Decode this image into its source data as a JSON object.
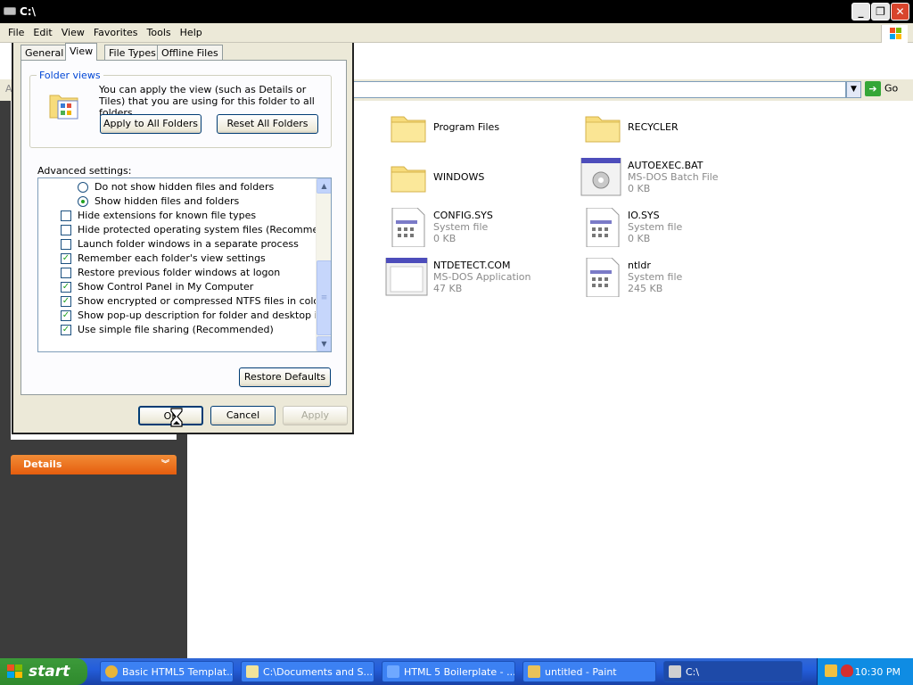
{
  "window": {
    "title": "C:\\"
  },
  "menu": [
    "File",
    "Edit",
    "View",
    "Favorites",
    "Tools",
    "Help"
  ],
  "address": {
    "go_label": "Go",
    "stub": "A"
  },
  "sidebar": {
    "details_label": "Details"
  },
  "files": [
    {
      "name": "Program Files",
      "type": "",
      "size": "",
      "icon": "folder-icon"
    },
    {
      "name": "RECYCLER",
      "type": "",
      "size": "",
      "icon": "folder-icon"
    },
    {
      "name": "WINDOWS",
      "type": "",
      "size": "",
      "icon": "folder-icon"
    },
    {
      "name": "AUTOEXEC.BAT",
      "type": "MS-DOS Batch File",
      "size": "0 KB",
      "icon": "batch-file-icon"
    },
    {
      "name": "CONFIG.SYS",
      "type": "System file",
      "size": "0 KB",
      "icon": "system-file-icon"
    },
    {
      "name": "IO.SYS",
      "type": "System file",
      "size": "0 KB",
      "icon": "system-file-icon"
    },
    {
      "name": "NTDETECT.COM",
      "type": "MS-DOS Application",
      "size": "47 KB",
      "icon": "dos-app-icon"
    },
    {
      "name": "ntldr",
      "type": "System file",
      "size": "245 KB",
      "icon": "system-file-icon"
    }
  ],
  "dialog": {
    "tabs": [
      "General",
      "View",
      "File Types",
      "Offline Files"
    ],
    "active_tab": "View",
    "folder_views_label": "Folder views",
    "folder_views_text": "You can apply the view (such as Details or Tiles) that you are using for this folder to all folders.",
    "apply_all_label": "Apply to All Folders",
    "reset_all_label": "Reset All Folders",
    "advanced_label": "Advanced settings:",
    "settings": [
      {
        "label": "Do not show hidden files and folders",
        "kind": "radio",
        "checked": false,
        "indent": true
      },
      {
        "label": "Show hidden files and folders",
        "kind": "radio",
        "checked": true,
        "indent": true
      },
      {
        "label": "Hide extensions for known file types",
        "kind": "checkbox",
        "checked": false,
        "indent": false
      },
      {
        "label": "Hide protected operating system files (Recommended)",
        "kind": "checkbox",
        "checked": false,
        "indent": false
      },
      {
        "label": "Launch folder windows in a separate process",
        "kind": "checkbox",
        "checked": false,
        "indent": false
      },
      {
        "label": "Remember each folder's view settings",
        "kind": "checkbox",
        "checked": true,
        "indent": false
      },
      {
        "label": "Restore previous folder windows at logon",
        "kind": "checkbox",
        "checked": false,
        "indent": false
      },
      {
        "label": "Show Control Panel in My Computer",
        "kind": "checkbox",
        "checked": true,
        "indent": false
      },
      {
        "label": "Show encrypted or compressed NTFS files in color",
        "kind": "checkbox",
        "checked": true,
        "indent": false
      },
      {
        "label": "Show pop-up description for folder and desktop items",
        "kind": "checkbox",
        "checked": true,
        "indent": false
      },
      {
        "label": "Use simple file sharing (Recommended)",
        "kind": "checkbox",
        "checked": true,
        "indent": false
      }
    ],
    "restore_defaults_label": "Restore Defaults",
    "ok_label": "OK",
    "cancel_label": "Cancel",
    "apply_label": "Apply"
  },
  "taskbar": {
    "start_label": "start",
    "tasks": [
      {
        "label": "Basic HTML5 Templat...",
        "icon": "chrome-icon",
        "color": "#e8b53a"
      },
      {
        "label": "C:\\Documents and S...",
        "icon": "notepad-icon",
        "color": "#f2e39a"
      },
      {
        "label": "HTML 5 Boilerplate - ...",
        "icon": "ie-icon",
        "color": "#6fa8ff"
      },
      {
        "label": "untitled - Paint",
        "icon": "paint-icon",
        "color": "#e9c25a"
      },
      {
        "label": "C:\\",
        "icon": "drive-icon",
        "color": "#d0d0d0",
        "active": true
      }
    ],
    "clock": "10:30 PM"
  },
  "colors": {
    "accent": "#e55d0e",
    "panel": "#3c3c3c",
    "taskbar": "#245edb",
    "start": "#3c9a3a"
  }
}
